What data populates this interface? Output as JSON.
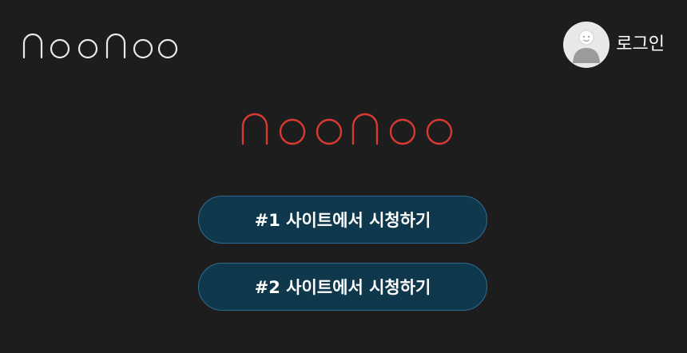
{
  "header": {
    "logo_text": "noonoo",
    "logo_color": "#e9e9e9",
    "login_label": "로그인",
    "avatar_icon": "user-avatar-icon"
  },
  "hero": {
    "logo_text": "noonoo",
    "logo_color": "#d83a32"
  },
  "buttons": [
    {
      "label": "#1 사이트에서 시청하기"
    },
    {
      "label": "#2 사이트에서 시청하기"
    }
  ],
  "colors": {
    "background": "#1d1d1d",
    "button_fill": "#0f384d",
    "button_border": "#2f6d94"
  }
}
